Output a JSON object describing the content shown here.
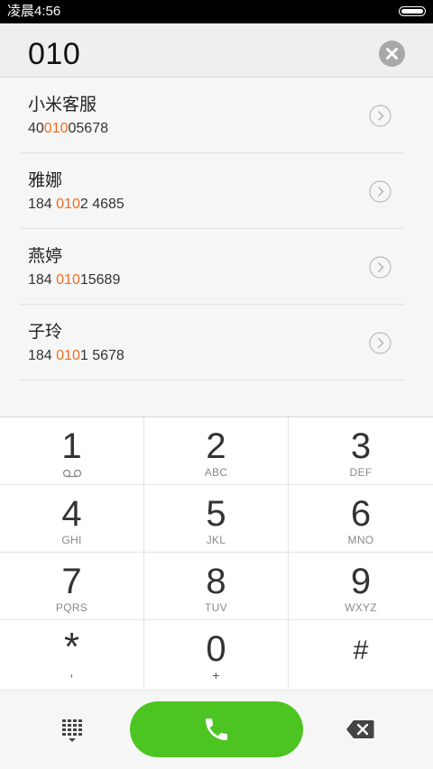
{
  "status_bar": {
    "time": "凌晨4:56"
  },
  "dial_input": {
    "number": "010"
  },
  "results": [
    {
      "name": "小米客服",
      "number_pre": "40",
      "number_hl": "010",
      "number_post": "05678"
    },
    {
      "name": "雅娜",
      "number_pre": "184 ",
      "number_hl": "010",
      "number_post": "2 4685"
    },
    {
      "name": "燕婷",
      "number_pre": "184 ",
      "number_hl": "010",
      "number_post": "15689"
    },
    {
      "name": "子玲",
      "number_pre": "184 ",
      "number_hl": "010",
      "number_post": "1 5678"
    }
  ],
  "keypad": {
    "k1": {
      "digit": "1",
      "letters": ""
    },
    "k2": {
      "digit": "2",
      "letters": "ABC"
    },
    "k3": {
      "digit": "3",
      "letters": "DEF"
    },
    "k4": {
      "digit": "4",
      "letters": "GHI"
    },
    "k5": {
      "digit": "5",
      "letters": "JKL"
    },
    "k6": {
      "digit": "6",
      "letters": "MNO"
    },
    "k7": {
      "digit": "7",
      "letters": "PQRS"
    },
    "k8": {
      "digit": "8",
      "letters": "TUV"
    },
    "k9": {
      "digit": "9",
      "letters": "WXYZ"
    },
    "kstar": {
      "digit": "*",
      "letters": ","
    },
    "k0": {
      "digit": "0",
      "letters": "+"
    },
    "khash": {
      "digit": "#",
      "letters": ""
    }
  },
  "colors": {
    "highlight": "#f06e1e",
    "call_green": "#4cc522"
  },
  "icons": {
    "clear": "clear-icon",
    "chevron": "chevron-right-icon",
    "voicemail": "voicemail-icon",
    "dialpad": "dialpad-icon",
    "call": "phone-icon",
    "backspace": "backspace-icon"
  }
}
